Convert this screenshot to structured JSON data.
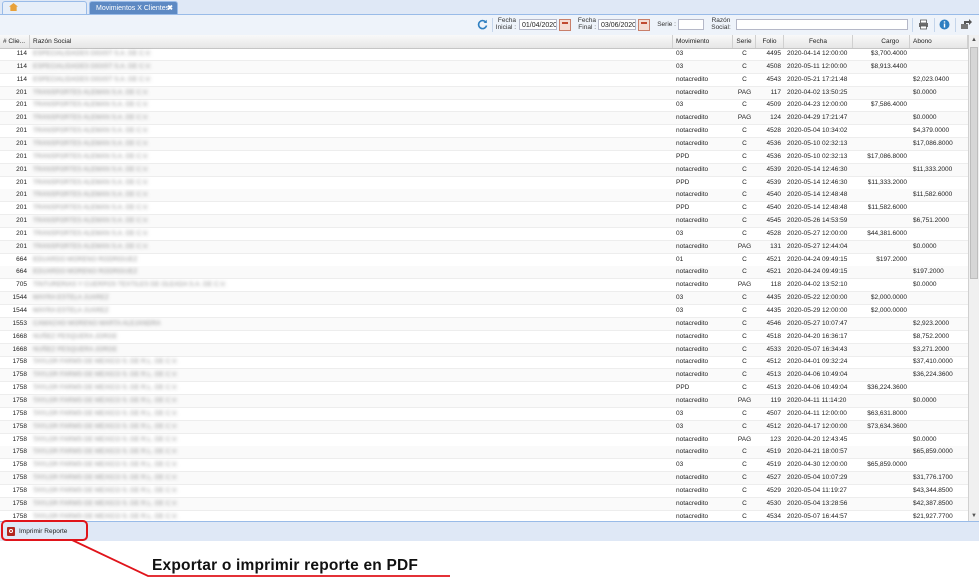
{
  "tabs": [
    {
      "label": "miplataformadecontrol",
      "active": false
    },
    {
      "label": "Movimientos X Clientes",
      "active": true
    }
  ],
  "toolbar": {
    "fecha_inicial_label": "Fecha Inicial :",
    "fecha_inicial_value": "01/04/2020",
    "fecha_final_label": "Fecha Final :",
    "fecha_final_value": "03/06/2020",
    "serie_label": "Serie :",
    "serie_value": "",
    "razon_label": "Razón Social:",
    "razon_value": ""
  },
  "columns": [
    "# Clie...",
    "Razón Social",
    "Movimiento",
    "Serie",
    "Folio",
    "Fecha",
    "Cargo",
    "Abono"
  ],
  "rows": [
    {
      "cliente": "114",
      "razon": "ESPECIALIDADES DIGIST S.A. DE C.V.",
      "mov": "03",
      "serie": "C",
      "folio": "4495",
      "fecha": "2020-04-14 12:00:00",
      "cargo": "$3,700.4000",
      "abono": ""
    },
    {
      "cliente": "114",
      "razon": "ESPECIALIDADES DIGIST S.A. DE C.V.",
      "mov": "03",
      "serie": "C",
      "folio": "4508",
      "fecha": "2020-05-11 12:00:00",
      "cargo": "$8,913.4400",
      "abono": ""
    },
    {
      "cliente": "114",
      "razon": "ESPECIALIDADES DIGIST S.A. DE C.V.",
      "mov": "notacredito",
      "serie": "C",
      "folio": "4543",
      "fecha": "2020-05-21 17:21:48",
      "cargo": "",
      "abono": "$2,023.0400"
    },
    {
      "cliente": "201",
      "razon": "TRANSPORTES ALEMAN S.A. DE C.V.",
      "mov": "notacredito",
      "serie": "PAG",
      "folio": "117",
      "fecha": "2020-04-02 13:50:25",
      "cargo": "",
      "abono": "$0.0000"
    },
    {
      "cliente": "201",
      "razon": "TRANSPORTES ALEMAN S.A. DE C.V.",
      "mov": "03",
      "serie": "C",
      "folio": "4509",
      "fecha": "2020-04-23 12:00:00",
      "cargo": "$7,586.4000",
      "abono": ""
    },
    {
      "cliente": "201",
      "razon": "TRANSPORTES ALEMAN S.A. DE C.V.",
      "mov": "notacredito",
      "serie": "PAG",
      "folio": "124",
      "fecha": "2020-04-29 17:21:47",
      "cargo": "",
      "abono": "$0.0000"
    },
    {
      "cliente": "201",
      "razon": "TRANSPORTES ALEMAN S.A. DE C.V.",
      "mov": "notacredito",
      "serie": "C",
      "folio": "4528",
      "fecha": "2020-05-04 10:34:02",
      "cargo": "",
      "abono": "$4,379.0000"
    },
    {
      "cliente": "201",
      "razon": "TRANSPORTES ALEMAN S.A. DE C.V.",
      "mov": "notacredito",
      "serie": "C",
      "folio": "4536",
      "fecha": "2020-05-10 02:32:13",
      "cargo": "",
      "abono": "$17,086.8000"
    },
    {
      "cliente": "201",
      "razon": "TRANSPORTES ALEMAN S.A. DE C.V.",
      "mov": "PPD",
      "serie": "C",
      "folio": "4536",
      "fecha": "2020-05-10 02:32:13",
      "cargo": "$17,086.8000",
      "abono": ""
    },
    {
      "cliente": "201",
      "razon": "TRANSPORTES ALEMAN S.A. DE C.V.",
      "mov": "notacredito",
      "serie": "C",
      "folio": "4539",
      "fecha": "2020-05-14 12:46:30",
      "cargo": "",
      "abono": "$11,333.2000"
    },
    {
      "cliente": "201",
      "razon": "TRANSPORTES ALEMAN S.A. DE C.V.",
      "mov": "PPD",
      "serie": "C",
      "folio": "4539",
      "fecha": "2020-05-14 12:46:30",
      "cargo": "$11,333.2000",
      "abono": ""
    },
    {
      "cliente": "201",
      "razon": "TRANSPORTES ALEMAN S.A. DE C.V.",
      "mov": "notacredito",
      "serie": "C",
      "folio": "4540",
      "fecha": "2020-05-14 12:48:48",
      "cargo": "",
      "abono": "$11,582.6000"
    },
    {
      "cliente": "201",
      "razon": "TRANSPORTES ALEMAN S.A. DE C.V.",
      "mov": "PPD",
      "serie": "C",
      "folio": "4540",
      "fecha": "2020-05-14 12:48:48",
      "cargo": "$11,582.6000",
      "abono": ""
    },
    {
      "cliente": "201",
      "razon": "TRANSPORTES ALEMAN S.A. DE C.V.",
      "mov": "notacredito",
      "serie": "C",
      "folio": "4545",
      "fecha": "2020-05-26 14:53:59",
      "cargo": "",
      "abono": "$6,751.2000"
    },
    {
      "cliente": "201",
      "razon": "TRANSPORTES ALEMAN S.A. DE C.V.",
      "mov": "03",
      "serie": "C",
      "folio": "4528",
      "fecha": "2020-05-27 12:00:00",
      "cargo": "$44,381.6000",
      "abono": ""
    },
    {
      "cliente": "201",
      "razon": "TRANSPORTES ALEMAN S.A. DE C.V.",
      "mov": "notacredito",
      "serie": "PAG",
      "folio": "131",
      "fecha": "2020-05-27 12:44:04",
      "cargo": "",
      "abono": "$0.0000"
    },
    {
      "cliente": "664",
      "razon": "EDUARDO MORENO RODRIGUEZ",
      "mov": "01",
      "serie": "C",
      "folio": "4521",
      "fecha": "2020-04-24 09:49:15",
      "cargo": "$197.2000",
      "abono": ""
    },
    {
      "cliente": "664",
      "razon": "EDUARDO MORENO RODRIGUEZ",
      "mov": "notacredito",
      "serie": "C",
      "folio": "4521",
      "fecha": "2020-04-24 09:49:15",
      "cargo": "",
      "abono": "$197.2000"
    },
    {
      "cliente": "705",
      "razon": "TINTURERIAS Y CUERPOS TEXTILES DE OLEADA S.A. DE C.V.",
      "mov": "notacredito",
      "serie": "PAG",
      "folio": "118",
      "fecha": "2020-04-02 13:52:10",
      "cargo": "",
      "abono": "$0.0000"
    },
    {
      "cliente": "1544",
      "razon": "MAYRA ESTELA JUAREZ",
      "mov": "03",
      "serie": "C",
      "folio": "4435",
      "fecha": "2020-05-22 12:00:00",
      "cargo": "$2,000.0000",
      "abono": ""
    },
    {
      "cliente": "1544",
      "razon": "MAYRA ESTELA JUAREZ",
      "mov": "03",
      "serie": "C",
      "folio": "4435",
      "fecha": "2020-05-29 12:00:00",
      "cargo": "$2,000.0000",
      "abono": ""
    },
    {
      "cliente": "1553",
      "razon": "CAMACHO MORENO MARTA ALEJANDRA",
      "mov": "notacredito",
      "serie": "C",
      "folio": "4546",
      "fecha": "2020-05-27 10:07:47",
      "cargo": "",
      "abono": "$2,923.2000"
    },
    {
      "cliente": "1668",
      "razon": "NUÑEZ PESQUERA JORGE",
      "mov": "notacredito",
      "serie": "C",
      "folio": "4518",
      "fecha": "2020-04-20 16:36:17",
      "cargo": "",
      "abono": "$8,752.2000"
    },
    {
      "cliente": "1668",
      "razon": "NUÑEZ PESQUERA JORGE",
      "mov": "notacredito",
      "serie": "C",
      "folio": "4533",
      "fecha": "2020-05-07 16:34:43",
      "cargo": "",
      "abono": "$3,271.2000"
    },
    {
      "cliente": "1758",
      "razon": "TAYLOR FARMS DE MEXICO S. DE R.L. DE C.V.",
      "mov": "notacredito",
      "serie": "C",
      "folio": "4512",
      "fecha": "2020-04-01 09:32:24",
      "cargo": "",
      "abono": "$37,410.0000"
    },
    {
      "cliente": "1758",
      "razon": "TAYLOR FARMS DE MEXICO S. DE R.L. DE C.V.",
      "mov": "notacredito",
      "serie": "C",
      "folio": "4513",
      "fecha": "2020-04-06 10:49:04",
      "cargo": "",
      "abono": "$36,224.3600"
    },
    {
      "cliente": "1758",
      "razon": "TAYLOR FARMS DE MEXICO S. DE R.L. DE C.V.",
      "mov": "PPD",
      "serie": "C",
      "folio": "4513",
      "fecha": "2020-04-06 10:49:04",
      "cargo": "$36,224.3600",
      "abono": ""
    },
    {
      "cliente": "1758",
      "razon": "TAYLOR FARMS DE MEXICO S. DE R.L. DE C.V.",
      "mov": "notacredito",
      "serie": "PAG",
      "folio": "119",
      "fecha": "2020-04-11 11:14:20",
      "cargo": "",
      "abono": "$0.0000"
    },
    {
      "cliente": "1758",
      "razon": "TAYLOR FARMS DE MEXICO S. DE R.L. DE C.V.",
      "mov": "03",
      "serie": "C",
      "folio": "4507",
      "fecha": "2020-04-11 12:00:00",
      "cargo": "$63,631.8000",
      "abono": ""
    },
    {
      "cliente": "1758",
      "razon": "TAYLOR FARMS DE MEXICO S. DE R.L. DE C.V.",
      "mov": "03",
      "serie": "C",
      "folio": "4512",
      "fecha": "2020-04-17 12:00:00",
      "cargo": "$73,634.3600",
      "abono": ""
    },
    {
      "cliente": "1758",
      "razon": "TAYLOR FARMS DE MEXICO S. DE R.L. DE C.V.",
      "mov": "notacredito",
      "serie": "PAG",
      "folio": "123",
      "fecha": "2020-04-20 12:43:45",
      "cargo": "",
      "abono": "$0.0000"
    },
    {
      "cliente": "1758",
      "razon": "TAYLOR FARMS DE MEXICO S. DE R.L. DE C.V.",
      "mov": "notacredito",
      "serie": "C",
      "folio": "4519",
      "fecha": "2020-04-21 18:00:57",
      "cargo": "",
      "abono": "$65,859.0000"
    },
    {
      "cliente": "1758",
      "razon": "TAYLOR FARMS DE MEXICO S. DE R.L. DE C.V.",
      "mov": "03",
      "serie": "C",
      "folio": "4519",
      "fecha": "2020-04-30 12:00:00",
      "cargo": "$65,859.0000",
      "abono": ""
    },
    {
      "cliente": "1758",
      "razon": "TAYLOR FARMS DE MEXICO S. DE R.L. DE C.V.",
      "mov": "notacredito",
      "serie": "C",
      "folio": "4527",
      "fecha": "2020-05-04 10:07:29",
      "cargo": "",
      "abono": "$31,776.1700"
    },
    {
      "cliente": "1758",
      "razon": "TAYLOR FARMS DE MEXICO S. DE R.L. DE C.V.",
      "mov": "notacredito",
      "serie": "C",
      "folio": "4529",
      "fecha": "2020-05-04 11:19:27",
      "cargo": "",
      "abono": "$43,344.8500"
    },
    {
      "cliente": "1758",
      "razon": "TAYLOR FARMS DE MEXICO S. DE R.L. DE C.V.",
      "mov": "notacredito",
      "serie": "C",
      "folio": "4530",
      "fecha": "2020-05-04 13:28:56",
      "cargo": "",
      "abono": "$42,387.8500"
    },
    {
      "cliente": "1758",
      "razon": "TAYLOR FARMS DE MEXICO S. DE R.L. DE C.V.",
      "mov": "notacredito",
      "serie": "C",
      "folio": "4534",
      "fecha": "2020-05-07 16:44:57",
      "cargo": "",
      "abono": "$21,927.7700"
    }
  ],
  "footer": {
    "print_label": "Imprimir Reporte"
  },
  "annotation": {
    "text": "Exportar o imprimir reporte en PDF",
    "color": "#e0141b"
  },
  "colors": {
    "accent": "#5d89c3",
    "annotation": "#e0141b"
  },
  "icons": [
    "home-icon",
    "refresh-icon",
    "calendar-icon",
    "print-icon",
    "info-icon",
    "export-icon",
    "pdf-icon"
  ]
}
